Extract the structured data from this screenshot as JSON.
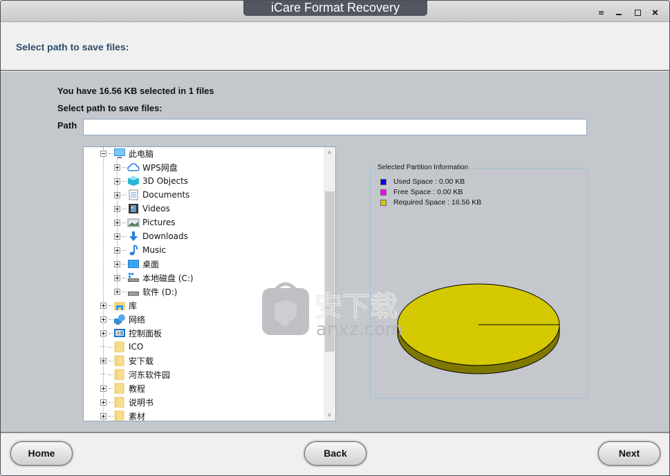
{
  "window": {
    "title": "iCare Format Recovery",
    "controls": [
      "menu-icon",
      "minimize-icon",
      "maximize-icon",
      "close-icon"
    ]
  },
  "header": {
    "title": "Select path to save files:"
  },
  "main": {
    "selection_summary": "You have 16.56 KB selected in 1 files",
    "select_path_label": "Select path to save files:",
    "path_label": "Path",
    "path_value": "",
    "path_placeholder": ""
  },
  "tree": {
    "nodes": [
      {
        "label": "此电脑",
        "icon": "computer-icon",
        "level": 0,
        "expander": "minus"
      },
      {
        "label": "WPS网盘",
        "icon": "cloud-icon",
        "level": 1,
        "expander": "plus"
      },
      {
        "label": "3D Objects",
        "icon": "cube-icon",
        "level": 1,
        "expander": "plus"
      },
      {
        "label": "Documents",
        "icon": "document-icon",
        "level": 1,
        "expander": "plus"
      },
      {
        "label": "Videos",
        "icon": "film-icon",
        "level": 1,
        "expander": "plus"
      },
      {
        "label": "Pictures",
        "icon": "picture-icon",
        "level": 1,
        "expander": "plus"
      },
      {
        "label": "Downloads",
        "icon": "download-arrow-icon",
        "level": 1,
        "expander": "plus"
      },
      {
        "label": "Music",
        "icon": "music-note-icon",
        "level": 1,
        "expander": "plus"
      },
      {
        "label": "桌面",
        "icon": "desktop-icon",
        "level": 1,
        "expander": "plus"
      },
      {
        "label": "本地磁盘 (C:)",
        "icon": "system-drive-icon",
        "level": 1,
        "expander": "plus"
      },
      {
        "label": "软件 (D:)",
        "icon": "drive-icon",
        "level": 1,
        "expander": "plus"
      },
      {
        "label": "库",
        "icon": "library-folder-icon",
        "level": 0,
        "expander": "plus"
      },
      {
        "label": "网络",
        "icon": "network-icon",
        "level": 0,
        "expander": "plus"
      },
      {
        "label": "控制面板",
        "icon": "control-panel-icon",
        "level": 0,
        "expander": "plus"
      },
      {
        "label": "ICO",
        "icon": "folder-icon",
        "level": 0,
        "expander": "none"
      },
      {
        "label": "安下载",
        "icon": "folder-icon",
        "level": 0,
        "expander": "plus"
      },
      {
        "label": "河东软件园",
        "icon": "folder-icon",
        "level": 0,
        "expander": "none"
      },
      {
        "label": "教程",
        "icon": "folder-icon",
        "level": 0,
        "expander": "plus"
      },
      {
        "label": "说明书",
        "icon": "folder-icon",
        "level": 0,
        "expander": "plus"
      },
      {
        "label": "素材",
        "icon": "folder-icon",
        "level": 0,
        "expander": "plus"
      }
    ],
    "scroll_up": "˄",
    "scroll_down": "˅"
  },
  "partition": {
    "title": "Selected Partition Information",
    "legend": [
      {
        "label": "Used Space : 0.00 KB",
        "color": "#0000ff"
      },
      {
        "label": "Free Space : 0.00 KB",
        "color": "#ff00ff"
      },
      {
        "label": "Required Space : 16.56 KB",
        "color": "#d4c800"
      }
    ]
  },
  "chart_data": {
    "type": "pie",
    "title": "Selected Partition Information",
    "style": "3d",
    "categories": [
      "Used Space",
      "Free Space",
      "Required Space"
    ],
    "values": [
      0.0,
      0.0,
      16.56
    ],
    "unit": "KB",
    "colors": [
      "#0000ff",
      "#ff00ff",
      "#d4c800"
    ],
    "legend_position": "top-left"
  },
  "watermark": {
    "text": "安下载",
    "subtext": "anxz.com"
  },
  "footer": {
    "home_label": "Home",
    "back_label": "Back",
    "next_label": "Next"
  }
}
